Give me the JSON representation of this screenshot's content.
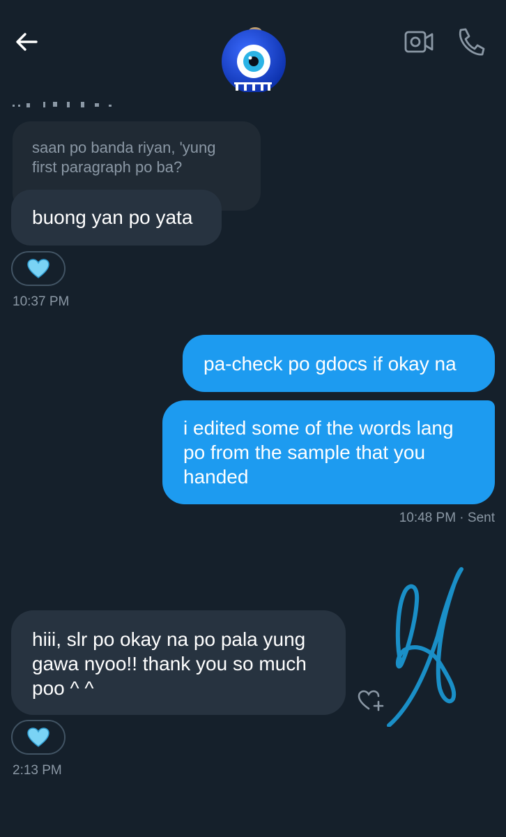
{
  "header": {
    "back_icon": "arrow-left-icon",
    "avatar_icon": "evil-eye-avatar",
    "video_icon": "video-camera-icon",
    "call_icon": "phone-icon"
  },
  "messages": {
    "quoted_text": "saan po banda riyan, 'yung\nfirst paragraph po ba?",
    "reply1": "buong yan po yata",
    "reaction1": "💙",
    "time1": "10:37 PM",
    "sent1": "pa-check po gdocs if okay na",
    "sent2": "i edited some of the words lang\npo from the sample that you\nhanded",
    "time2": "10:48 PM · Sent",
    "reply2": "hiii, slr po okay na po pala yung\ngawa nyoo!! thank you so much\npoo ^ ^",
    "reaction2": "💙",
    "time3": "2:13 PM"
  },
  "colors": {
    "background": "#15202b",
    "received_bubble": "#273340",
    "sent_bubble": "#1d9bf0",
    "signature": "#1a8fc7"
  }
}
